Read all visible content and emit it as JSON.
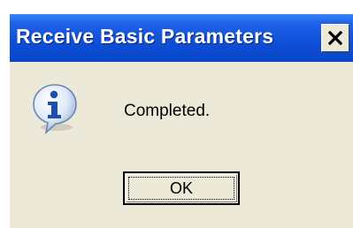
{
  "dialog": {
    "title": "Receive Basic Parameters",
    "close_glyph": "✕",
    "icon": "information-icon",
    "message": "Completed.",
    "ok_label": "OK"
  },
  "colors": {
    "titlebar": "#0d4fd8",
    "face": "#ece9d8",
    "title_text": "#ffffff"
  }
}
